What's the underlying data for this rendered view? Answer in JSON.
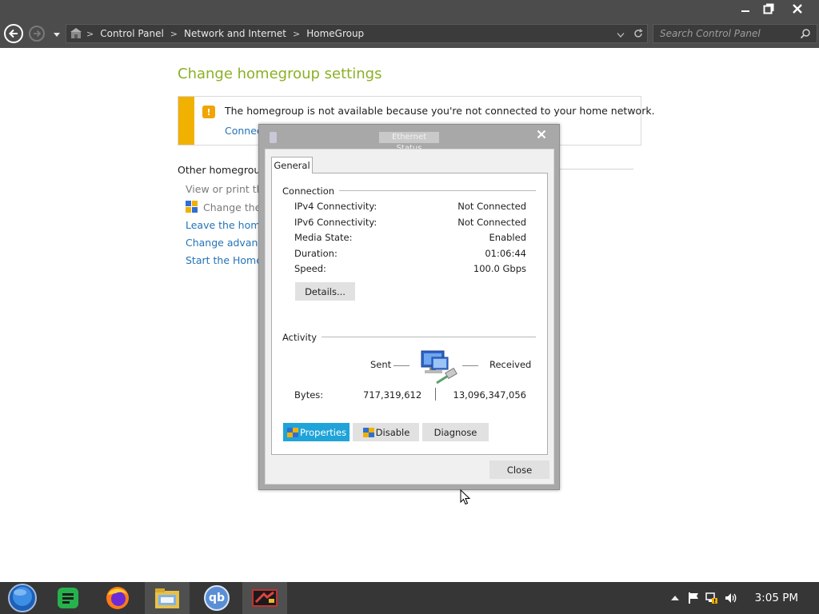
{
  "window": {
    "controls": {
      "minimize": "—",
      "maximize": "❐",
      "close": "✕"
    }
  },
  "address": {
    "crumbs": [
      "Control Panel",
      "Network and Internet",
      "HomeGroup"
    ],
    "separator": ">"
  },
  "search": {
    "placeholder": "Search Control Panel"
  },
  "page": {
    "title": "Change homegroup settings",
    "alert": {
      "icon": "homegroup-warning-icon",
      "text": "The homegroup is not available because you're not connected to your home network.",
      "link": "Connec"
    },
    "other_heading": "Other homegroup a",
    "items": [
      {
        "text": "View or print the ",
        "style": "gray"
      },
      {
        "text": "Change the p",
        "style": "gray"
      },
      {
        "text": "Leave the homeg",
        "style": "link"
      },
      {
        "text": "Change advanced",
        "style": "link"
      },
      {
        "text": "Start the HomeGr",
        "style": "link"
      }
    ]
  },
  "dialog": {
    "title": "Ethernet Status",
    "tab": "General",
    "connection": {
      "label": "Connection",
      "rows": [
        {
          "label": "IPv4 Connectivity:",
          "value": "Not Connected"
        },
        {
          "label": "IPv6 Connectivity:",
          "value": "Not Connected"
        },
        {
          "label": "Media State:",
          "value": "Enabled"
        },
        {
          "label": "Duration:",
          "value": "01:06:44"
        },
        {
          "label": "Speed:",
          "value": "100.0 Gbps"
        }
      ],
      "details_button": "Details..."
    },
    "activity": {
      "label": "Activity",
      "sent_label": "Sent",
      "received_label": "Received",
      "bytes_label": "Bytes:",
      "bytes_sent": "717,319,612",
      "bytes_received": "13,096,347,056"
    },
    "buttons": {
      "properties": "Properties",
      "disable": "Disable",
      "diagnose": "Diagnose",
      "close": "Close"
    }
  },
  "taskbar": {
    "apps": [
      "start-orb",
      "notes-app",
      "firefox",
      "file-explorer",
      "qbittorrent",
      "media-app"
    ],
    "qb_label": "qb",
    "clock": "3:05 PM"
  },
  "colors": {
    "accent": "#1fa3d8",
    "title_green": "#8bb026",
    "link_blue": "#2473b8",
    "alert_yellow": "#f0b100",
    "chrome_dark": "#4c4c4c",
    "taskbar": "#363636"
  }
}
